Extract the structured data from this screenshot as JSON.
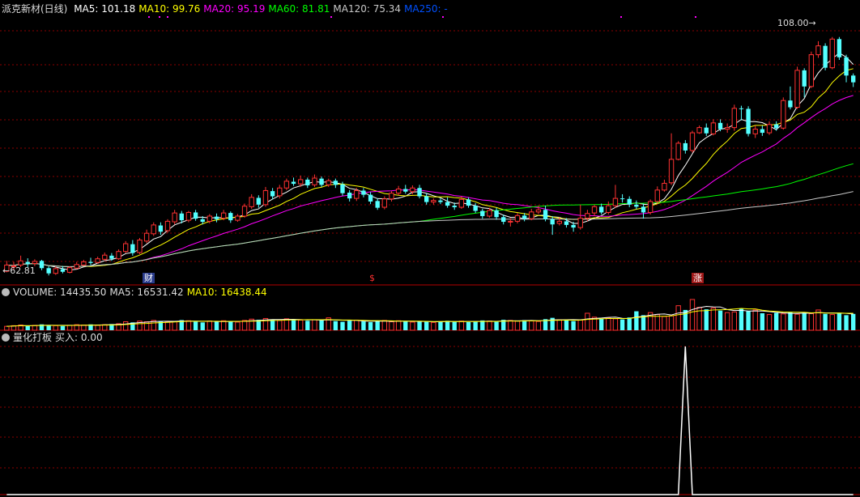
{
  "price_panel": {
    "stock_title": "派克新材(日线)",
    "ma_labels": [
      {
        "text": "MA5: 101.18",
        "color": "#ffffff"
      },
      {
        "text": "MA10: 99.76",
        "color": "#ffff00"
      },
      {
        "text": "MA20: 95.19",
        "color": "#ff00ff"
      },
      {
        "text": "MA60: 81.81",
        "color": "#00ff00"
      },
      {
        "text": "MA120: 75.34",
        "color": "#c8c8c8"
      },
      {
        "text": "MA250: -",
        "color": "#0050ff"
      }
    ],
    "high_label": "108.00",
    "low_label": "62.81",
    "markers": [
      {
        "text": "财",
        "bg": "#2a3c8c",
        "fg": "#ffffff"
      },
      {
        "text": "$",
        "bg": "#000000",
        "fg": "#ff3030"
      },
      {
        "text": "涨",
        "bg": "#a01818",
        "fg": "#ffffff"
      }
    ]
  },
  "volume_panel": {
    "title": "VOLUME: 14435.50",
    "ma5": "MA5: 16531.42",
    "ma10": "MA10: 16438.44"
  },
  "indicator_panel": {
    "title": "量化打板",
    "value": "买入: 0.00"
  },
  "colors": {
    "up": "#ff3232",
    "down": "#54ffff",
    "grid": "#8b0000",
    "separator": "#b40000"
  },
  "chart_data": [
    {
      "type": "candlestick",
      "title": "派克新材(日线)",
      "ylim": [
        61,
        112
      ],
      "candles": [
        [
          63.0,
          64.2,
          65.0,
          62.81
        ],
        [
          64.0,
          64.0,
          64.8,
          63.2
        ],
        [
          64.2,
          65.0,
          66.0,
          63.8
        ],
        [
          64.8,
          64.4,
          65.5,
          63.8
        ],
        [
          64.5,
          64.9,
          65.3,
          64.0
        ],
        [
          65.0,
          63.6,
          65.2,
          63.2
        ],
        [
          63.6,
          62.6,
          64.0,
          62.2
        ],
        [
          62.6,
          63.5,
          63.9,
          62.3
        ],
        [
          63.4,
          62.9,
          64.0,
          62.6
        ],
        [
          62.8,
          63.7,
          64.0,
          62.6
        ],
        [
          63.6,
          64.3,
          64.8,
          63.4
        ],
        [
          64.2,
          64.8,
          65.2,
          64.0
        ],
        [
          64.8,
          64.6,
          65.6,
          64.2
        ],
        [
          64.7,
          65.4,
          65.8,
          64.5
        ],
        [
          65.3,
          66.1,
          66.6,
          65.0
        ],
        [
          66.0,
          65.4,
          66.5,
          65.0
        ],
        [
          65.4,
          66.8,
          67.2,
          65.2
        ],
        [
          66.8,
          68.3,
          68.8,
          66.5
        ],
        [
          68.2,
          66.5,
          69.0,
          66.0
        ],
        [
          66.6,
          69.0,
          69.4,
          66.3
        ],
        [
          68.8,
          70.3,
          71.0,
          68.4
        ],
        [
          70.2,
          71.9,
          72.4,
          69.8
        ],
        [
          71.8,
          70.6,
          72.4,
          70.0
        ],
        [
          70.8,
          72.6,
          73.0,
          70.4
        ],
        [
          72.5,
          74.2,
          74.8,
          72.0
        ],
        [
          74.1,
          72.8,
          74.6,
          72.2
        ],
        [
          72.8,
          74.3,
          74.6,
          72.4
        ],
        [
          74.3,
          73.1,
          74.8,
          72.7
        ],
        [
          73.0,
          72.5,
          73.6,
          72.0
        ],
        [
          72.6,
          73.6,
          74.0,
          72.2
        ],
        [
          73.5,
          73.0,
          74.1,
          72.4
        ],
        [
          73.2,
          74.2,
          74.8,
          72.8
        ],
        [
          74.2,
          72.8,
          74.5,
          72.3
        ],
        [
          72.8,
          73.6,
          74.0,
          72.5
        ],
        [
          73.6,
          75.5,
          76.0,
          73.3
        ],
        [
          75.4,
          77.2,
          77.8,
          75.0
        ],
        [
          77.1,
          75.8,
          77.6,
          75.2
        ],
        [
          75.8,
          78.5,
          79.2,
          75.4
        ],
        [
          78.4,
          77.4,
          79.0,
          76.8
        ],
        [
          77.5,
          79.0,
          79.6,
          77.0
        ],
        [
          79.0,
          80.3,
          80.8,
          78.6
        ],
        [
          80.2,
          79.8,
          81.0,
          79.4
        ],
        [
          79.8,
          80.6,
          81.4,
          79.2
        ],
        [
          80.6,
          79.5,
          81.0,
          79.0
        ],
        [
          79.6,
          80.9,
          81.6,
          79.2
        ],
        [
          80.8,
          79.6,
          81.2,
          79.2
        ],
        [
          79.6,
          80.4,
          80.8,
          79.2
        ],
        [
          80.4,
          79.6,
          80.8,
          79.0
        ],
        [
          79.7,
          78.0,
          80.2,
          77.5
        ],
        [
          78.1,
          77.0,
          78.6,
          76.4
        ],
        [
          77.0,
          78.5,
          79.0,
          76.5
        ],
        [
          78.5,
          77.7,
          79.0,
          77.2
        ],
        [
          77.7,
          76.4,
          78.2,
          75.9
        ],
        [
          76.5,
          75.2,
          77.0,
          74.8
        ],
        [
          75.3,
          76.9,
          77.4,
          74.9
        ],
        [
          76.9,
          78.0,
          78.4,
          76.4
        ],
        [
          78.0,
          78.8,
          79.4,
          77.6
        ],
        [
          78.8,
          78.3,
          79.6,
          77.9
        ],
        [
          78.3,
          79.0,
          79.5,
          77.8
        ],
        [
          79.0,
          77.4,
          79.6,
          77.0
        ],
        [
          77.4,
          76.3,
          78.0,
          75.8
        ],
        [
          76.3,
          76.6,
          77.0,
          75.8
        ],
        [
          76.6,
          76.3,
          77.0,
          75.9
        ],
        [
          76.3,
          75.6,
          77.2,
          75.2
        ],
        [
          75.6,
          75.3,
          76.2,
          74.8
        ],
        [
          75.3,
          76.8,
          77.4,
          75.0
        ],
        [
          76.8,
          75.6,
          77.2,
          75.2
        ],
        [
          75.6,
          74.6,
          76.1,
          74.2
        ],
        [
          74.6,
          73.6,
          75.0,
          73.1
        ],
        [
          73.6,
          74.7,
          75.2,
          73.3
        ],
        [
          74.7,
          73.4,
          75.2,
          72.9
        ],
        [
          73.4,
          72.5,
          73.9,
          72.0
        ],
        [
          72.5,
          72.6,
          73.2,
          71.6
        ],
        [
          72.6,
          73.7,
          74.2,
          72.2
        ],
        [
          73.7,
          73.1,
          74.2,
          72.6
        ],
        [
          73.1,
          74.4,
          75.0,
          72.8
        ],
        [
          74.4,
          74.8,
          75.6,
          74.0
        ],
        [
          74.8,
          73.0,
          75.6,
          72.6
        ],
        [
          73.0,
          72.0,
          73.6,
          70.0
        ],
        [
          72.2,
          72.6,
          73.4,
          71.8
        ],
        [
          72.6,
          71.9,
          73.2,
          71.4
        ],
        [
          71.9,
          71.4,
          72.5,
          70.6
        ],
        [
          71.4,
          73.2,
          75.8,
          71.0
        ],
        [
          73.2,
          74.1,
          74.8,
          72.6
        ],
        [
          74.2,
          75.4,
          75.8,
          73.6
        ],
        [
          75.4,
          74.3,
          76.0,
          73.9
        ],
        [
          74.3,
          75.6,
          76.4,
          73.9
        ],
        [
          75.6,
          77.0,
          79.6,
          75.2
        ],
        [
          77.0,
          76.9,
          77.8,
          76.2
        ],
        [
          76.9,
          75.8,
          77.4,
          75.3
        ],
        [
          75.8,
          75.4,
          76.6,
          74.9
        ],
        [
          75.4,
          74.3,
          76.0,
          73.1
        ],
        [
          74.3,
          76.4,
          76.8,
          73.9
        ],
        [
          76.4,
          78.6,
          79.3,
          76.0
        ],
        [
          78.6,
          79.9,
          80.6,
          78.3
        ],
        [
          80.0,
          84.5,
          89.5,
          79.6
        ],
        [
          84.5,
          87.6,
          88.0,
          84.3
        ],
        [
          87.6,
          86.2,
          88.2,
          85.6
        ],
        [
          86.2,
          89.6,
          90.0,
          85.8
        ],
        [
          89.6,
          90.6,
          91.0,
          89.4
        ],
        [
          90.6,
          89.5,
          91.4,
          89.0
        ],
        [
          89.4,
          91.5,
          92.2,
          89.1
        ],
        [
          91.5,
          90.3,
          92.2,
          89.9
        ],
        [
          90.3,
          90.6,
          91.4,
          89.6
        ],
        [
          90.6,
          94.3,
          95.0,
          90.0
        ],
        [
          94.3,
          94.2,
          94.8,
          92.0
        ],
        [
          94.2,
          89.4,
          94.7,
          88.9
        ],
        [
          89.4,
          90.3,
          91.0,
          88.6
        ],
        [
          90.3,
          89.6,
          91.0,
          89.0
        ],
        [
          89.6,
          91.2,
          91.8,
          89.2
        ],
        [
          91.2,
          90.5,
          91.8,
          90.0
        ],
        [
          90.5,
          95.8,
          96.4,
          90.2
        ],
        [
          95.8,
          94.5,
          98.5,
          94.1
        ],
        [
          94.5,
          101.6,
          102.3,
          94.2
        ],
        [
          101.6,
          98.5,
          102.0,
          96.4
        ],
        [
          98.5,
          104.6,
          105.2,
          98.2
        ],
        [
          104.6,
          106.3,
          107.2,
          104.0
        ],
        [
          106.3,
          102.1,
          106.8,
          101.6
        ],
        [
          102.1,
          107.6,
          108.0,
          101.8
        ],
        [
          107.6,
          104.1,
          108.0,
          103.6
        ],
        [
          104.1,
          100.6,
          104.6,
          99.3
        ],
        [
          100.6,
          99.3,
          101.0,
          98.4
        ]
      ]
    },
    {
      "type": "bar",
      "title": "VOLUME: 14435.50",
      "values": [
        1.2,
        1.4,
        1.6,
        1.3,
        1.5,
        1.8,
        1.6,
        1.4,
        1.3,
        1.5,
        1.7,
        1.6,
        1.8,
        1.5,
        1.7,
        1.9,
        2.0,
        2.6,
        2.4,
        2.8,
        2.6,
        3.0,
        2.8,
        2.5,
        2.7,
        3.1,
        2.9,
        2.6,
        2.4,
        2.8,
        2.6,
        2.9,
        2.7,
        2.5,
        3.0,
        3.4,
        3.2,
        3.6,
        3.3,
        3.0,
        3.5,
        3.3,
        3.1,
        2.9,
        3.2,
        3.0,
        3.8,
        2.8,
        2.6,
        2.9,
        3.1,
        2.7,
        2.5,
        2.8,
        3.0,
        2.6,
        2.9,
        2.7,
        2.5,
        2.8,
        2.6,
        2.4,
        2.7,
        2.9,
        2.6,
        2.8,
        2.5,
        2.7,
        3.0,
        2.8,
        2.6,
        3.2,
        3.0,
        2.8,
        3.1,
        2.9,
        2.7,
        3.4,
        3.8,
        3.2,
        3.0,
        2.8,
        3.1,
        5.2,
        4.0,
        3.6,
        3.8,
        3.5,
        3.3,
        3.9,
        5.8,
        4.6,
        5.4,
        4.8,
        4.2,
        4.4,
        7.5,
        6.2,
        9.4,
        7.0,
        6.4,
        6.8,
        6.0,
        5.4,
        5.6,
        6.6,
        5.8,
        6.2,
        5.2,
        4.8,
        5.3,
        5.0,
        5.6,
        4.9,
        5.4,
        5.1,
        6.2,
        5.0,
        4.8,
        5.3,
        4.6,
        5.0
      ]
    },
    {
      "type": "line",
      "title": "量化打板",
      "ylim": [
        0,
        1
      ],
      "values": [
        0,
        0,
        0,
        0,
        0,
        0,
        0,
        0,
        0,
        0,
        0,
        0,
        0,
        0,
        0,
        0,
        0,
        0,
        0,
        0,
        0,
        0,
        0,
        0,
        0,
        0,
        0,
        0,
        0,
        0,
        0,
        0,
        0,
        0,
        0,
        0,
        0,
        0,
        0,
        0,
        0,
        0,
        0,
        0,
        0,
        0,
        0,
        0,
        0,
        0,
        0,
        0,
        0,
        0,
        0,
        0,
        0,
        0,
        0,
        0,
        0,
        0,
        0,
        0,
        0,
        0,
        0,
        0,
        0,
        0,
        0,
        0,
        0,
        0,
        0,
        0,
        0,
        0,
        0,
        0,
        0,
        0,
        0,
        0,
        0,
        0,
        0,
        0,
        0,
        0,
        0,
        0,
        0,
        0,
        0,
        0,
        0,
        1,
        0,
        0,
        0,
        0,
        0,
        0,
        0,
        0,
        0,
        0,
        0,
        0,
        0,
        0,
        0,
        0,
        0,
        0,
        0,
        0,
        0,
        0,
        0,
        0
      ]
    }
  ]
}
